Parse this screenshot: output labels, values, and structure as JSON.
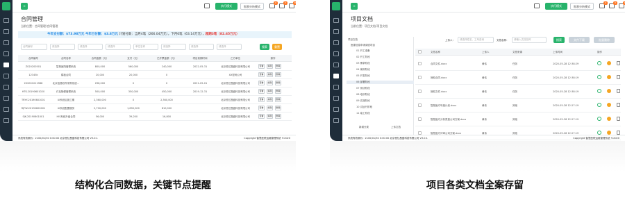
{
  "left": {
    "topbar": {
      "mode_primary": "执行模式",
      "mode_secondary": "报表分析模式",
      "badges": [
        "0",
        "3",
        "8"
      ]
    },
    "title": "合同管理",
    "breadcrumb": "当前位置：合同管理/合同管理",
    "stats": {
      "plan_pay_label": "今年支付额：",
      "plan_pay": "$73.98万元",
      "actual_pay_label": "今年已付额：",
      "actual_pay": "$3.8万元",
      "plan_label": "计划付款：",
      "plan_text": "当月4笔（266.04万元），下月6笔（63.14万元），",
      "overdue": "超期3笔（82.65万元）"
    },
    "filters": [
      "合同编号",
      "请选择",
      "请选择",
      "请选择",
      "单位名称",
      "请选择",
      "请选择",
      "请选择"
    ],
    "buttons": {
      "search": "搜索",
      "reset": "重置"
    },
    "columns": [
      "合同编号",
      "合同名称",
      "合同金额（元）",
      "支付（元）",
      "已开票金额（元）",
      "项目到期时间",
      "乙方单位",
      "操作"
    ],
    "rows": [
      [
        "Z020200501",
        "智慧医院管理系统",
        "800,000",
        "560,000",
        "240,000",
        "2022-05-31",
        "北京恒亿昌盛科技有限公司"
      ],
      [
        "12345k",
        "模板合同",
        "20,000",
        "20,000",
        "0",
        "",
        "XX密码公司"
      ],
      [
        "202001011988",
        "北京信息软件采购系统…",
        "298,000",
        "0",
        "0",
        "2021-05-01",
        "北京恒亿昌盛科技有限公司"
      ],
      [
        "HTK-20190601020",
        "疗后随便管理系统",
        "500,000",
        "350,000",
        "450,000",
        "2019-12-31",
        "北京恒亿昌盛科技有限公司"
      ],
      [
        "TRYY-20190601001",
        "UI系统后施工期",
        "2,360,000",
        "0",
        "2,360,000",
        "",
        "北京恒亿昌盛科技有限公司"
      ],
      [
        "RJFW-20190600001",
        "UI系统配置服务",
        "2,700,000",
        "1,890,000",
        "810,000",
        "",
        "北京恒亿昌盛科技有限公司"
      ],
      [
        "SJK-20190601001",
        "HIS系统升级合同",
        "56,000",
        "39,200",
        "16,800",
        "",
        "北京恒亿昌盛科技有限公司"
      ]
    ],
    "ops": [
      "查看",
      "编辑",
      "删除"
    ],
    "footer": {
      "left": "系统有效期为：2100/01/30 0:00:00 北京恒亿昌盛科技有限公司 V3.0.1",
      "right": "Copyright 智慧医院运维管理系统 ©2020"
    }
  },
  "right": {
    "topbar": {
      "mode_primary": "执行模式",
      "mode_secondary": "报表分析模式",
      "badges": [
        "0",
        "3",
        "8"
      ]
    },
    "title": "项目文档",
    "breadcrumb": "当前位置：项目文档/项目文档",
    "filters": {
      "uploader_label": "上传人：",
      "uploader_ph": "请选择姓名、工号查询",
      "name_label": "文档名称：",
      "name_ph": "请输入文档名称"
    },
    "buttons": {
      "search": "搜索",
      "download": "文件下载",
      "delete": "批量删除"
    },
    "tree_root": "项目文档",
    "tree_project": "医患信息申请调查项目",
    "tree_nodes": [
      "01 开工准备",
      "02 开工阶段",
      "03 需求阶段",
      "04 案例阶段",
      "05 开发阶段",
      "06 部署阶段",
      "07 测试阶段",
      "08 培训阶段",
      "09 实施阶段",
      "10 试运行阶段",
      "11 竣工阶段"
    ],
    "tree_buttons": {
      "add": "新增分类",
      "upload": "上传文档"
    },
    "columns": [
      "文档名称",
      "上传人",
      "文档来源",
      "上传时间",
      "操作"
    ],
    "rows": [
      [
        "合同文件.docx",
        "黄伟",
        "任务",
        "2020-05-28 12:38:29"
      ],
      [
        "授权合同.docx",
        "黄伟",
        "任务",
        "2020-05-28 12:38:19"
      ],
      [
        "授权文件.docx",
        "黄伟",
        "任务",
        "2020-05-28 12:38:19"
      ],
      [
        "智慧医疗年度计划.docx",
        "黄伟",
        "其他",
        "2020-05-28 12:27:19"
      ],
      [
        "智慧医疗分析质量公司方案.docx",
        "黄伟",
        "其他",
        "2020-05-28 12:27:19"
      ],
      [
        "智慧医疗评审公司方案.docx",
        "黄伟",
        "其他",
        "2020-05-28 12:27:19"
      ]
    ],
    "footer": {
      "left": "系统有效期为：2100/01/30 0:00:00 北京恒亿昌盛科技有限公司 V3.0.1",
      "right": "Copyright 智慧医院运维管理系统 ©2020"
    }
  },
  "captions": {
    "left": "结构化合同数据，关键节点提醒",
    "right": "项目各类文档全案存留"
  }
}
